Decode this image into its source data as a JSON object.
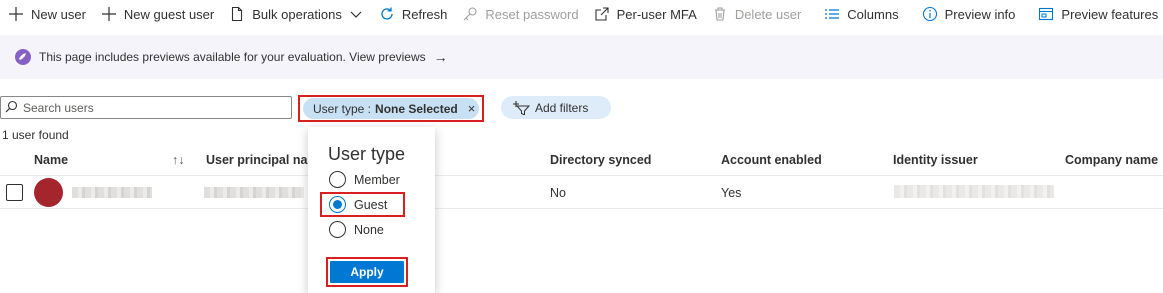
{
  "toolbar": {
    "new_user": "New user",
    "new_guest_user": "New guest user",
    "bulk_operations": "Bulk operations",
    "refresh": "Refresh",
    "reset_password": "Reset password",
    "per_user_mfa": "Per-user MFA",
    "delete_user": "Delete user",
    "columns": "Columns",
    "preview_info": "Preview info",
    "preview_features": "Preview features"
  },
  "banner": {
    "text": "This page includes previews available for your evaluation. View previews",
    "arrow": "→"
  },
  "search": {
    "placeholder": "Search users",
    "value": ""
  },
  "filter": {
    "label": "User type :",
    "value": "None Selected",
    "close": "×",
    "add_filters": "Add filters"
  },
  "results": {
    "count_text": "1 user found"
  },
  "table": {
    "headers": [
      "Name",
      "User principal nar",
      "Directory synced",
      "Account enabled",
      "Identity issuer",
      "Company name"
    ],
    "sort_icon": "↑↓",
    "rows": [
      {
        "directory_synced": "No",
        "account_enabled": "Yes"
      }
    ]
  },
  "dropdown": {
    "title": "User type",
    "options": [
      "Member",
      "Guest",
      "None"
    ],
    "selected": "Guest",
    "apply_label": "Apply"
  },
  "colors": {
    "accent": "#0078d4",
    "highlight": "#d8201f",
    "avatar": "#a4262c",
    "banner_bg": "#f6f4fb",
    "pill_bg": "#c7e0f4"
  }
}
